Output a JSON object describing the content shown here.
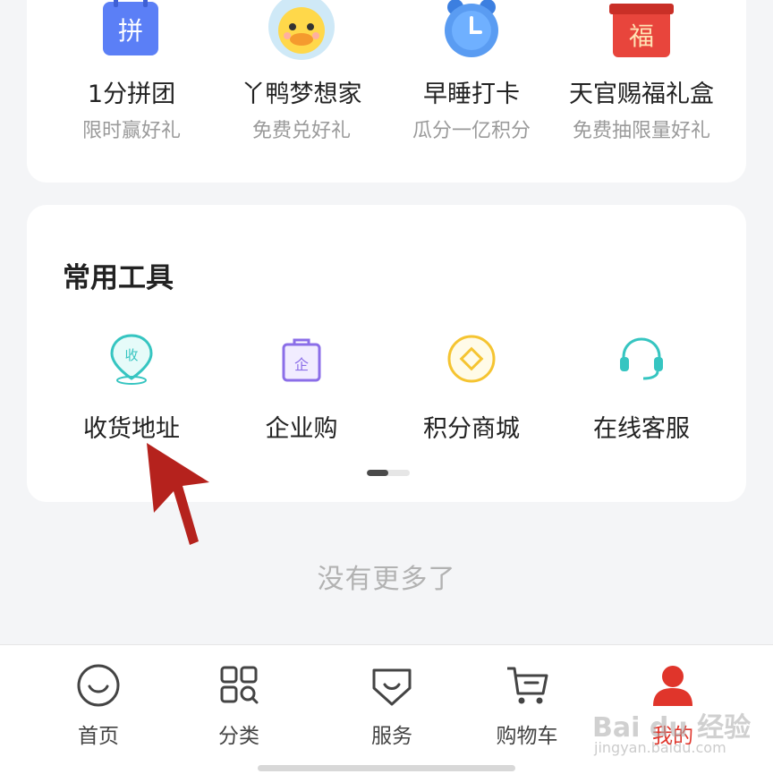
{
  "promo": {
    "items": [
      {
        "title": "1分拼团",
        "subtitle": "限时赢好礼",
        "icon_glyph": "拼",
        "icon": "pin-calendar-icon",
        "color": "#5b7ff6"
      },
      {
        "title": "丫鸭梦想家",
        "subtitle": "免费兑好礼",
        "icon": "duck-icon",
        "color": "#ffd84a"
      },
      {
        "title": "早睡打卡",
        "subtitle": "瓜分一亿积分",
        "icon": "alarm-clock-icon",
        "color": "#5a9cf2"
      },
      {
        "title": "天官赐福礼盒",
        "subtitle": "免费抽限量好礼",
        "icon_glyph": "福",
        "icon": "gift-box-icon",
        "color": "#e8453c"
      }
    ]
  },
  "tools": {
    "title": "常用工具",
    "items": [
      {
        "label": "收货地址",
        "icon": "address-pin-icon",
        "icon_glyph": "收",
        "color": "#36c5c1"
      },
      {
        "label": "企业购",
        "icon": "enterprise-bag-icon",
        "icon_glyph": "企",
        "color": "#8b6ee8"
      },
      {
        "label": "积分商城",
        "icon": "points-coin-icon",
        "color": "#f5c431"
      },
      {
        "label": "在线客服",
        "icon": "headset-icon",
        "color": "#36c5c1"
      }
    ],
    "pager": {
      "current": 1,
      "total": 2
    }
  },
  "footer_text": "没有更多了",
  "tabbar": {
    "tabs": [
      {
        "label": "首页",
        "icon": "home-smile-icon",
        "active": false
      },
      {
        "label": "分类",
        "icon": "category-grid-icon",
        "active": false
      },
      {
        "label": "服务",
        "icon": "service-icon",
        "active": false
      },
      {
        "label": "购物车",
        "icon": "cart-icon",
        "active": false
      },
      {
        "label": "我的",
        "icon": "profile-icon",
        "active": true
      }
    ],
    "active_color": "#e0352b"
  },
  "watermark": {
    "text": "Bai du 经验",
    "sub": "jingyan.baidu.com"
  }
}
